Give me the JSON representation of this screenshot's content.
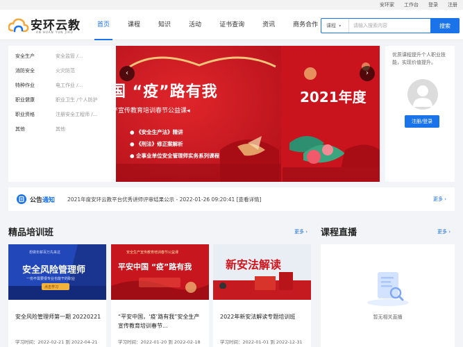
{
  "topbar": {
    "links": [
      "安环家",
      "工作台",
      "登录",
      "注册"
    ]
  },
  "logo": {
    "name": "安环云教",
    "sub": "AN HUAN YUN JIAO"
  },
  "nav": {
    "items": [
      "首页",
      "课程",
      "知识",
      "活动",
      "证书查询",
      "资讯",
      "商务合作"
    ],
    "active_index": 0
  },
  "search": {
    "type": "课程",
    "placeholder": "请输入搜索内容",
    "button": "搜索"
  },
  "categories": [
    {
      "name": "安全生产",
      "sub": "安全监管 /..."
    },
    {
      "name": "消防安全",
      "sub": "火灾防范"
    },
    {
      "name": "特种作业",
      "sub": "电工作业 /..."
    },
    {
      "name": "职业健康",
      "sub": "职业卫生 /个人防护"
    },
    {
      "name": "职业资格",
      "sub": "注册安全工程师 /..."
    },
    {
      "name": "其他",
      "sub": "其他"
    }
  ],
  "banner": {
    "title": "国  “疫”路有我",
    "subtitle": "产宣传教育培训春节公益课◂",
    "bullets": [
      "《安全生产法》精讲",
      "《刑法》修正案解析",
      "企事业单位安全管理师实务系列课程"
    ],
    "next_title": "2021年度"
  },
  "user": {
    "tip": "优质课程提升个人职业技能，实现价值提升。",
    "login": "注册/登录"
  },
  "notice": {
    "label": "公告",
    "label_blue": "通知",
    "text": "2021年度安环云教平台优秀讲师评审结果公示 - 2022-01-26 09:20:41 [查看详情]",
    "more": "更多 ›"
  },
  "sections": {
    "training": {
      "title": "精品培训班",
      "more": "更多 ›"
    },
    "live": {
      "title": "课程直播",
      "more": "更多 ›",
      "empty": "暂无相关直播"
    }
  },
  "cards": [
    {
      "title": "安全风险管理师第一期 20220221",
      "time": "学习时间：2022-02-21 到 2022-04-21",
      "img_main": "安全风险管理师",
      "img_top": "想做年薪百万先来这",
      "img_mid": "一份不需要很专业也能干的职业",
      "img_btn": "点击学习"
    },
    {
      "title": "“平安中国，‘疫’路有我”安全生产宣传教育培训春节...",
      "time": "学习时间：2022-01-20 到 2022-02-18",
      "img_main": "平安中国 “疫”路有我",
      "img_top": "安全生产宣传教育培训春节公益课"
    },
    {
      "title": "2022年新安法解读专题培训班",
      "time": "学习时间：2022-01-01 到 2022-12-31",
      "img_main": "新安法解读",
      "img_top": ""
    }
  ]
}
